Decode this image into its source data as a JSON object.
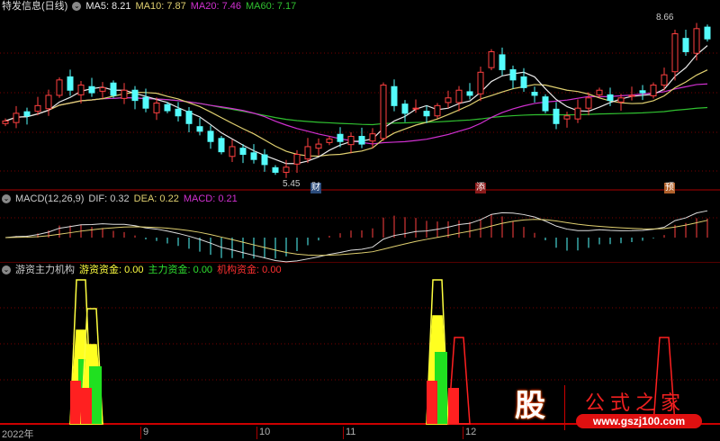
{
  "main_header": {
    "title": "特发信息(日线)",
    "ma5": "MA5: 8.21",
    "ma10": "MA10: 7.87",
    "ma20": "MA20: 7.46",
    "ma60": "MA60: 7.17"
  },
  "macd_header": {
    "title": "MACD(12,26,9)",
    "dif": "DIF: 0.32",
    "dea": "DEA: 0.22",
    "macd": "MACD: 0.21"
  },
  "fund_header": {
    "title": "游资主力机构",
    "youzi": "游资资金: 0.00",
    "zhuli": "主力资金: 0.00",
    "jigou": "机构资金: 0.00"
  },
  "annotations": {
    "high": "8.66",
    "low": "5.45"
  },
  "markers": [
    "财",
    "添",
    "预"
  ],
  "x_axis": [
    "2022年",
    "9",
    "10",
    "11",
    "12"
  ],
  "logo": {
    "badge": "股",
    "name": "公式之家",
    "url": "www.gszj100.com"
  },
  "colors": {
    "up": "#ff4040",
    "down": "#54fcfc",
    "ma5": "#e8e8e8",
    "ma10": "#e0d070",
    "ma20": "#d030d0",
    "ma60": "#30c030"
  },
  "chart_data": {
    "type": "candlestick",
    "price_range": [
      5.45,
      8.66
    ],
    "closes": [
      6.6,
      6.75,
      6.7,
      6.9,
      7.1,
      7.4,
      7.2,
      7.3,
      7.15,
      7.25,
      7.1,
      7.2,
      7.0,
      6.85,
      6.95,
      6.8,
      6.7,
      6.55,
      6.4,
      6.2,
      6.0,
      6.1,
      5.95,
      5.85,
      5.75,
      5.6,
      5.7,
      5.95,
      6.1,
      6.15,
      6.25,
      6.2,
      6.3,
      6.15,
      6.35,
      7.3,
      6.9,
      6.75,
      6.85,
      6.7,
      6.9,
      7.05,
      7.2,
      7.1,
      7.55,
      7.95,
      7.6,
      7.4,
      7.25,
      7.1,
      6.8,
      6.55,
      6.7,
      6.85,
      7.05,
      7.2,
      7.0,
      7.05,
      7.1,
      7.15,
      7.3,
      7.5,
      8.3,
      7.95,
      8.4,
      8.2
    ],
    "fund_signals": [
      {
        "index": 7,
        "red": 30,
        "yellow": 65,
        "green": 45,
        "outline": 100
      },
      {
        "index": 8,
        "red": 25,
        "yellow": 55,
        "green": 40,
        "outline": 80
      },
      {
        "index": 40,
        "red": 30,
        "yellow": 75,
        "green": 50,
        "outline": 100
      },
      {
        "index": 42,
        "red": 25,
        "yellow": 0,
        "green": 0,
        "outline": 60
      },
      {
        "index": 61,
        "red": 0,
        "yellow": 0,
        "green": 0,
        "outline": 60
      }
    ]
  }
}
